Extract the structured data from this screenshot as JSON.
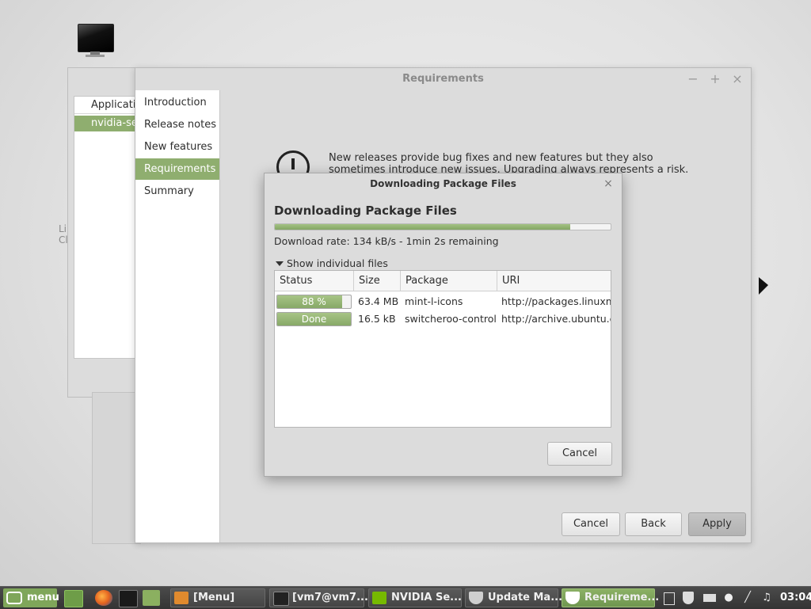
{
  "bg_window": {
    "list_header": "Application",
    "selected_item": "nvidia-settings",
    "ghost_line1": "Li",
    "ghost_line2": "Cl"
  },
  "req_window": {
    "title": "Requirements",
    "controls": {
      "minimize": "−",
      "maximize": "+",
      "close": "×"
    },
    "sidebar": [
      {
        "label": "Introduction",
        "active": false
      },
      {
        "label": "Release notes",
        "active": false
      },
      {
        "label": "New features",
        "active": false
      },
      {
        "label": "Requirements",
        "active": true
      },
      {
        "label": "Summary",
        "active": false
      }
    ],
    "warning_text": "New releases provide bug fixes and new features but they also sometimes introduce new issues. Upgrading always represents a risk. Your data is safe",
    "buttons": {
      "cancel": "Cancel",
      "back": "Back",
      "apply": "Apply"
    }
  },
  "download_dialog": {
    "title": "Downloading Package Files",
    "close": "×",
    "heading": "Downloading Package Files",
    "overall_progress": 0.88,
    "rate_text": "Download rate: 134 kB/s - 1min 2s remaining",
    "expander_label": "Show individual files",
    "columns": [
      "Status",
      "Size",
      "Package",
      "URI"
    ],
    "rows": [
      {
        "status": "88 %",
        "progress": 0.88,
        "size": "63.4 MB",
        "package": "mint-l-icons",
        "uri": "http://packages.linuxmint.com"
      },
      {
        "status": "Done",
        "progress": 1.0,
        "size": "16.5 kB",
        "package": "switcheroo-control",
        "uri": "http://archive.ubuntu.com"
      }
    ],
    "cancel": "Cancel"
  },
  "taskbar": {
    "menu_label": "menu",
    "tasks": [
      {
        "label": "[Menu]",
        "icon": "settings-icon",
        "color": "#e08a2e",
        "active": false
      },
      {
        "label": "[vm7@vm7...",
        "icon": "terminal-icon",
        "color": "#222222",
        "active": false
      },
      {
        "label": "NVIDIA Se...",
        "icon": "nvidia-icon",
        "color": "#76b900",
        "active": false
      },
      {
        "label": "Update Ma...",
        "icon": "shield-icon",
        "color": "#cfcfcf",
        "active": false
      },
      {
        "label": "Requireme...",
        "icon": "shield-icon",
        "color": "#ffffff",
        "active": true
      }
    ],
    "clock": "03:04"
  },
  "colors": {
    "accent": "#8fae6f",
    "taskbar": "#3c3c3c"
  }
}
